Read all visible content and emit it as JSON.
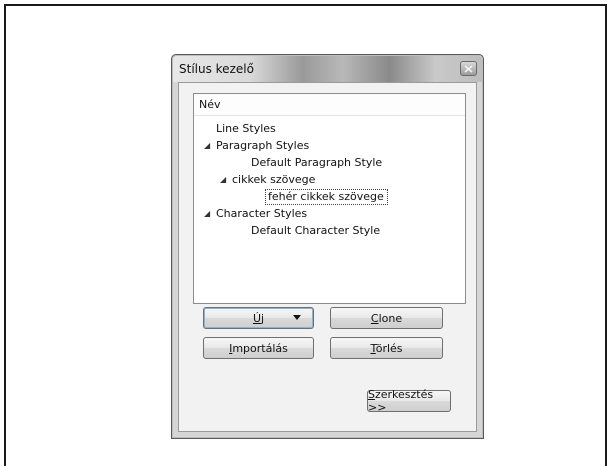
{
  "window": {
    "title": "Stílus kezelő"
  },
  "tree": {
    "header": "Név",
    "rows": [
      {
        "label": "Line Styles",
        "level": 0,
        "expander": false
      },
      {
        "label": "Paragraph Styles",
        "level": 0,
        "expander": true
      },
      {
        "label": "Default Paragraph Style",
        "level": 2,
        "expander": false
      },
      {
        "label": "cikkek szövege",
        "level": 1,
        "expander": true
      },
      {
        "label": "fehér cikkek szövege",
        "level": 3,
        "expander": false,
        "selected": true
      },
      {
        "label": "Character Styles",
        "level": 0,
        "expander": true
      },
      {
        "label": "Default Character Style",
        "level": 2,
        "expander": false
      }
    ]
  },
  "buttons": {
    "new": {
      "label": "Új",
      "mnemonic": "Ú",
      "rest": "j"
    },
    "clone": {
      "label": "Clone",
      "mnemonic": "C",
      "rest": "lone"
    },
    "import": {
      "label": "Importálás",
      "mnemonic": "I",
      "rest": "mportálás"
    },
    "delete": {
      "label": "Törlés",
      "mnemonic": "T",
      "rest": "örlés"
    },
    "edit": {
      "label": "Szerkesztés >>",
      "mnemonic": "S",
      "rest": "zerkesztés >>"
    }
  },
  "icons": {
    "close": "close-icon",
    "expander": "triangle-expanded-icon",
    "dropdown": "dropdown-arrow-icon"
  }
}
